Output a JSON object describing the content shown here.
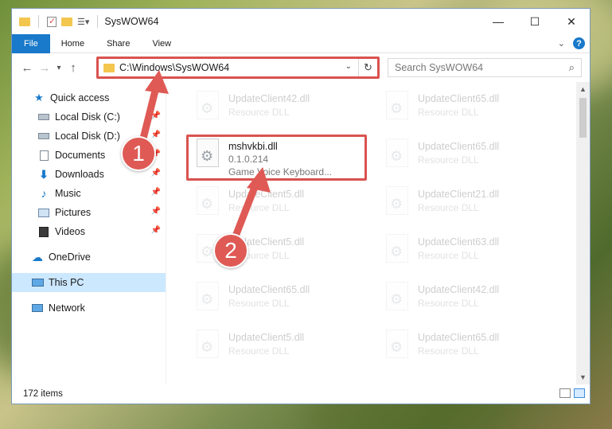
{
  "window": {
    "title": "SysWOW64",
    "controls": {
      "minimize": "—",
      "maximize": "☐",
      "close": "✕"
    }
  },
  "ribbon": {
    "tabs": [
      "File",
      "Home",
      "Share",
      "View"
    ],
    "expand_icon": "chevron-down-icon",
    "help_label": "?"
  },
  "navigation": {
    "back": "←",
    "forward": "→",
    "recent": "▾",
    "up": "↑"
  },
  "address": {
    "path": "C:\\Windows\\SysWOW64",
    "dropdown": "⌄",
    "refresh": "↻"
  },
  "search": {
    "placeholder": "Search SysWOW64",
    "icon": "⌕"
  },
  "sidebar": {
    "items": [
      {
        "label": "Quick access",
        "icon": "star-icon",
        "pinned": false
      },
      {
        "label": "Local Disk (C:)",
        "icon": "drive-icon",
        "pinned": true
      },
      {
        "label": "Local Disk (D:)",
        "icon": "drive-icon",
        "pinned": true
      },
      {
        "label": "Documents",
        "icon": "documents-icon",
        "pinned": true
      },
      {
        "label": "Downloads",
        "icon": "download-icon",
        "pinned": true
      },
      {
        "label": "Music",
        "icon": "music-icon",
        "pinned": true
      },
      {
        "label": "Pictures",
        "icon": "pictures-icon",
        "pinned": true
      },
      {
        "label": "Videos",
        "icon": "videos-icon",
        "pinned": true
      },
      {
        "label": "OneDrive",
        "icon": "cloud-icon",
        "pinned": false
      },
      {
        "label": "This PC",
        "icon": "computer-icon",
        "pinned": false
      },
      {
        "label": "Network",
        "icon": "network-icon",
        "pinned": false
      }
    ],
    "pin_glyph": "📌"
  },
  "files": {
    "highlighted": {
      "name": "mshvkbi.dll",
      "version": "0.1.0.214",
      "description": "Game Voice Keyboard..."
    },
    "left_column": [
      {
        "name": "UpdateClient42.dll",
        "type": "Resource DLL"
      },
      {
        "name": "UpdateClient5.dll",
        "type": "Resource DLL"
      },
      {
        "name": "UpdateClient5.dll",
        "type": "Resource DLL"
      },
      {
        "name": "UpdateClient65.dll",
        "type": "Resource DLL"
      },
      {
        "name": "UpdateClient5.dll",
        "type": "Resource DLL"
      }
    ],
    "right_column": [
      {
        "name": "UpdateClient65.dll",
        "type": "Resource DLL"
      },
      {
        "name": "UpdateClient65.dll",
        "type": "Resource DLL"
      },
      {
        "name": "UpdateClient21.dll",
        "type": "Resource DLL"
      },
      {
        "name": "UpdateClient63.dll",
        "type": "Resource DLL"
      },
      {
        "name": "UpdateClient42.dll",
        "type": "Resource DLL"
      },
      {
        "name": "UpdateClient65.dll",
        "type": "Resource DLL"
      }
    ]
  },
  "status": {
    "item_count": "172 items"
  },
  "annotations": {
    "step1": "1",
    "step2": "2",
    "color": "#df5a55"
  }
}
